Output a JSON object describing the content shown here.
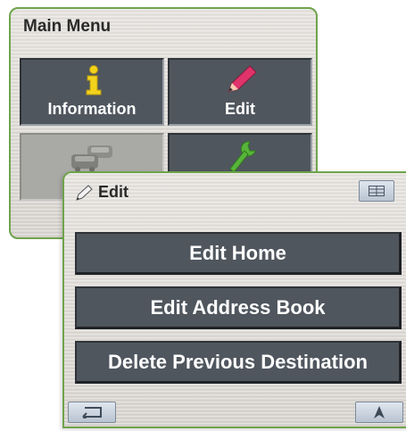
{
  "main_menu": {
    "title": "Main Menu",
    "tiles": [
      {
        "label": "Information",
        "icon": "info-icon"
      },
      {
        "label": "Edit",
        "icon": "pencil-icon"
      },
      {
        "label": "",
        "icon": "traffic-cars-icon",
        "disabled": true
      },
      {
        "label": "",
        "icon": "wrench-icon"
      }
    ]
  },
  "edit_window": {
    "title": "Edit",
    "title_icon": "pencil-icon",
    "corner_icon": "grid-icon",
    "buttons": [
      {
        "label": "Edit Home"
      },
      {
        "label": "Edit Address Book"
      },
      {
        "label": "Delete Previous Destination"
      }
    ],
    "bottom_left_icon": "back-arrow-icon",
    "bottom_right_icon": "navigation-arrow-icon"
  },
  "colors": {
    "frame_green": "#6fa44c",
    "button_gray": "#4f565e",
    "info_yellow": "#f3d21b",
    "pencil_pink": "#e0336b",
    "wrench_green": "#58b43a"
  }
}
